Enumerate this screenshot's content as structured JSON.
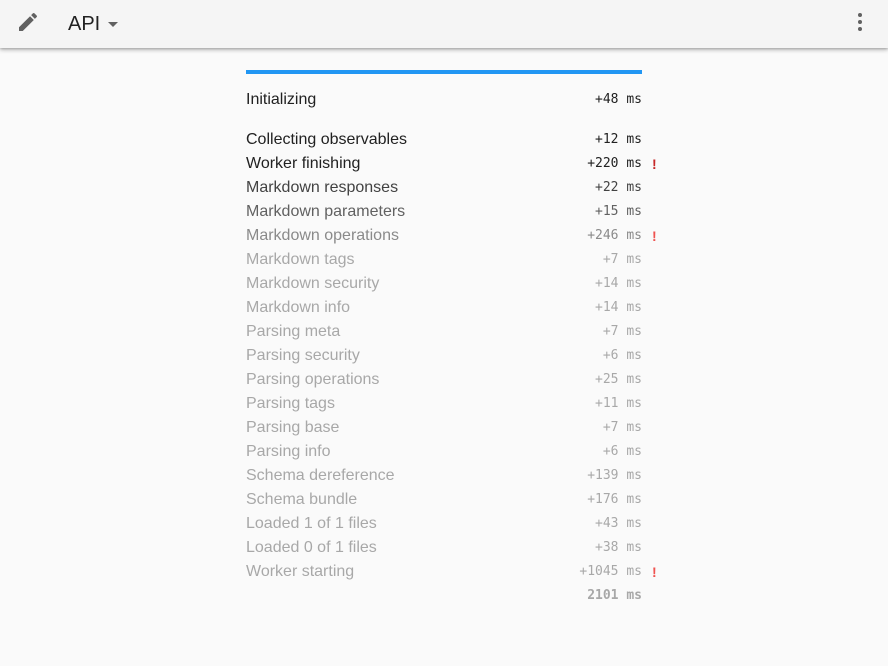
{
  "toolbar": {
    "edit_icon": "pencil-icon",
    "title": "API",
    "more_icon": "more-vert-icon"
  },
  "progress": {
    "fraction": 1.0,
    "fill_color": "#2196f3",
    "track_color": "#bbdefb"
  },
  "initializing": {
    "label": "Initializing",
    "time": "+48 ms"
  },
  "steps": [
    {
      "label": "Collecting observables",
      "time": "+12 ms",
      "warn": "",
      "color": "#212121"
    },
    {
      "label": "Worker finishing",
      "time": "+220 ms",
      "warn": "!",
      "color": "#212121"
    },
    {
      "label": "Markdown responses",
      "time": "+22 ms",
      "warn": "",
      "color": "#424242"
    },
    {
      "label": "Markdown parameters",
      "time": "+15 ms",
      "warn": "",
      "color": "#616161"
    },
    {
      "label": "Markdown operations",
      "time": "+246 ms",
      "warn": "!",
      "color": "#8a8a8a"
    },
    {
      "label": "Markdown tags",
      "time": "+7 ms",
      "warn": "",
      "color": "#a8a8a8"
    },
    {
      "label": "Markdown security",
      "time": "+14 ms",
      "warn": "",
      "color": "#a8a8a8"
    },
    {
      "label": "Markdown info",
      "time": "+14 ms",
      "warn": "",
      "color": "#a8a8a8"
    },
    {
      "label": "Parsing meta",
      "time": "+7 ms",
      "warn": "",
      "color": "#a8a8a8"
    },
    {
      "label": "Parsing security",
      "time": "+6 ms",
      "warn": "",
      "color": "#a8a8a8"
    },
    {
      "label": "Parsing operations",
      "time": "+25 ms",
      "warn": "",
      "color": "#a8a8a8"
    },
    {
      "label": "Parsing tags",
      "time": "+11 ms",
      "warn": "",
      "color": "#a8a8a8"
    },
    {
      "label": "Parsing base",
      "time": "+7 ms",
      "warn": "",
      "color": "#a8a8a8"
    },
    {
      "label": "Parsing info",
      "time": "+6 ms",
      "warn": "",
      "color": "#a8a8a8"
    },
    {
      "label": "Schema dereference",
      "time": "+139 ms",
      "warn": "",
      "color": "#a8a8a8"
    },
    {
      "label": "Schema bundle",
      "time": "+176 ms",
      "warn": "",
      "color": "#a8a8a8"
    },
    {
      "label": "Loaded 1 of 1 files",
      "time": "+43 ms",
      "warn": "",
      "color": "#a8a8a8"
    },
    {
      "label": "Loaded 0 of 1 files",
      "time": "+38 ms",
      "warn": "",
      "color": "#a8a8a8"
    },
    {
      "label": "Worker starting",
      "time": "+1045 ms",
      "warn": "!",
      "color": "#a8a8a8"
    }
  ],
  "total": "2101 ms",
  "colors": {
    "warn_strong": "#c62828",
    "warn_faded": "#ef5350"
  }
}
